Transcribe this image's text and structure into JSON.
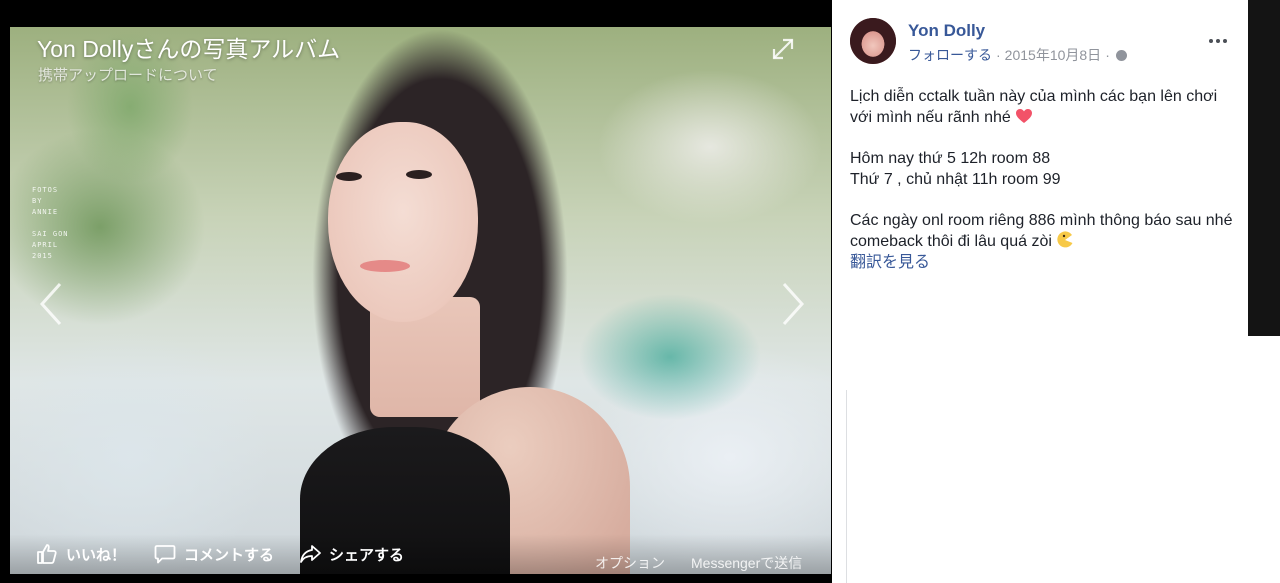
{
  "viewer": {
    "album_title": "Yon Dollyさんの写真アルバム",
    "album_subtitle": "携帯アップロードについて",
    "photo_watermark": "FOTOS\nBY\nANNIE\n\nSAI GON\nAPRIL\n2015",
    "actions": {
      "like": "いいね！",
      "comment": "コメントする",
      "share": "シェアする",
      "options": "オプション",
      "messenger": "Messengerで送信"
    }
  },
  "post": {
    "author": "Yon Dolly",
    "follow": "フォローする",
    "date": "2015年10月8日",
    "separator": "·",
    "lines": [
      "Lịch diễn cctalk tuần này của mình các bạn lên chơi với mình nếu rãnh nhé",
      "Hôm nay thứ 5 12h room 88",
      "Thứ 7 , chủ nhật 11h room 99",
      "Các ngày onl room riêng 886 mình thông báo sau nhé comeback thôi đi lâu quá zòi"
    ],
    "translate": "翻訳を見る"
  },
  "icons": [
    "expand-icon",
    "chevron-left-icon",
    "chevron-right-icon",
    "thumbs-up-icon",
    "comment-icon",
    "share-icon",
    "globe-icon",
    "more-icon",
    "heart-emoji-icon",
    "pacman-emoji-icon"
  ],
  "colors": {
    "link": "#385898",
    "text": "#1d2129",
    "meta": "#90949c",
    "viewer_bg": "#000000"
  }
}
